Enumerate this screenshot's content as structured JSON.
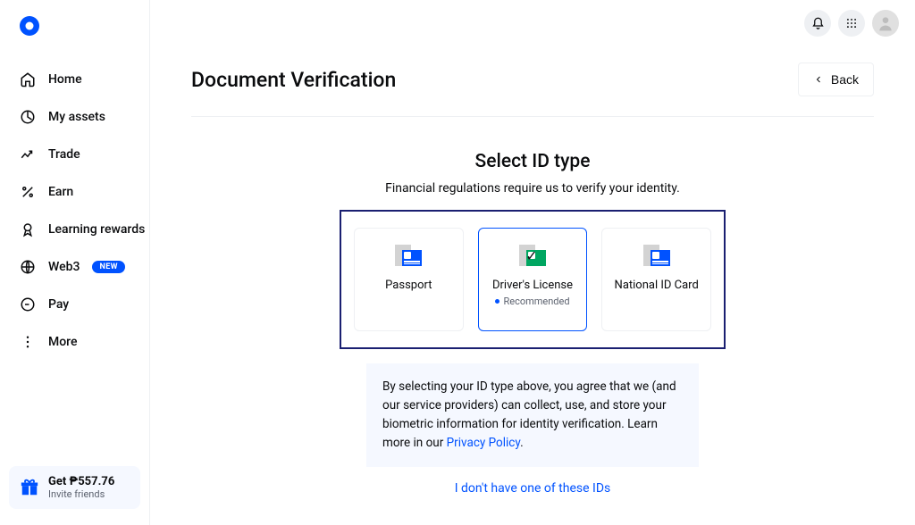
{
  "sidebar": {
    "items": [
      {
        "label": "Home"
      },
      {
        "label": "My assets"
      },
      {
        "label": "Trade"
      },
      {
        "label": "Earn"
      },
      {
        "label": "Learning rewards"
      },
      {
        "label": "Web3",
        "badge": "NEW"
      },
      {
        "label": "Pay"
      },
      {
        "label": "More"
      }
    ]
  },
  "invite": {
    "title": "Get ₱557.76",
    "sub": "Invite friends"
  },
  "page": {
    "title": "Document Verification",
    "back": "Back",
    "heading": "Select ID type",
    "sub": "Financial regulations require us to verify your identity.",
    "id_types": {
      "passport": "Passport",
      "license": "Driver's License",
      "license_note": "Recommended",
      "national": "National ID Card"
    },
    "disclaimer_1": "By selecting your ID type above, you agree that we (and our service providers) can collect, use, and store your biometric information for identity verification. Learn more in our ",
    "disclaimer_link": "Privacy Policy",
    "disclaimer_2": ".",
    "alt_link": "I don't have one of these IDs"
  }
}
